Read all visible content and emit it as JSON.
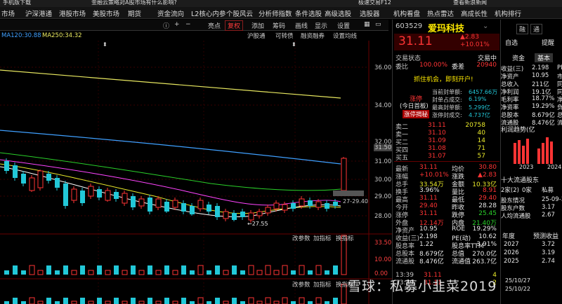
{
  "topbar": {
    "items": [
      "手机版下载",
      "金融云策略对A股市场有什么影响?",
      "极速交易F12",
      "查看新浪新闻"
    ]
  },
  "menubar": {
    "items": [
      "市场",
      "沪深港通",
      "港股市场",
      "美股市场",
      "期货",
      "资金流向",
      "L2核心内参",
      "个股风云",
      "分析师指数",
      "条件选股",
      "高级选股",
      "选股器",
      "机构看盘",
      "热点雷达",
      "高成长性",
      "机构排行"
    ]
  },
  "chart_toolbar": {
    "items": [
      "亮点",
      "复权",
      "添加",
      "筹码",
      "画线",
      "显示",
      "设置"
    ],
    "right_items": [
      "沪股通",
      "可转债",
      "融资融券",
      "设置均线"
    ]
  },
  "ma_legend": {
    "ma120": "MA120:30.88",
    "ma250": "MA250:34.32"
  },
  "colors": {
    "ma120": "#3fa0ff",
    "ma250": "#e8e860",
    "ma5": "#ffffff",
    "ma10": "#e8e82a",
    "ma20": "#ff44ff",
    "ma60": "#2ad02a",
    "up": "#ff3434",
    "down": "#22c8d8"
  },
  "price_axis": {
    "ticks": [
      "36.00",
      "34.00",
      "32.00",
      "31.50",
      "31.00",
      "30.00",
      "29.00",
      "28.00"
    ],
    "current": "31.50"
  },
  "chart_annotations": {
    "low_label": "27.55",
    "range_label": "27-29.40"
  },
  "volume_panel": {
    "buttons": [
      "改参数",
      "加指标",
      "换指标"
    ],
    "ticks": [
      "33.50",
      "10.00",
      "0.00"
    ]
  },
  "indicator_panel": {
    "buttons": [
      "改参数",
      "加指标",
      "换指标"
    ]
  },
  "stock": {
    "code": "603529",
    "name": "爱玛科技",
    "price": "31.11",
    "change": "▲2.83",
    "change_pct": "+10.01%"
  },
  "trade_status": {
    "label": "交易状态",
    "right": "交易中",
    "weibi_label": "委比",
    "weibi": "100.00%",
    "weicha_label": "委差",
    "weicha": "20940"
  },
  "banner": "抓住机会，即刻开户!",
  "limit_up": {
    "title": "涨停",
    "subtitle": "(今日首板)",
    "tag": "涨停揭秘",
    "lines": [
      {
        "label": "当前封单额:",
        "value": "6457.66万"
      },
      {
        "label": "封单占成交:",
        "value": "6.19%"
      },
      {
        "label": "最高封单额:",
        "value": "5.299亿"
      },
      {
        "label": "涨停封成交:",
        "value": "4.737亿"
      }
    ]
  },
  "order_book": {
    "sell": [
      {
        "label": "卖二",
        "price": "31.11",
        "vol": "20758"
      },
      {
        "label": "卖一",
        "price": "31.10",
        "vol": "40"
      },
      {
        "label": "买二",
        "price": "31.09",
        "vol": "14"
      },
      {
        "label": "买四",
        "price": "31.08",
        "vol": "71"
      },
      {
        "label": "买五",
        "price": "31.07",
        "vol": "57"
      }
    ]
  },
  "quote": [
    {
      "l1": "最新",
      "v1": "31.11",
      "c1": "red",
      "l2": "均价",
      "v2": "30.80",
      "c2": "red"
    },
    {
      "l1": "涨幅",
      "v1": "+10.01%",
      "c1": "red",
      "l2": "涨跌",
      "v2": "▲2.83",
      "c2": "red"
    },
    {
      "l1": "总手",
      "v1": "33.54万",
      "c1": "yellow",
      "l2": "金额",
      "v2": "10.33亿",
      "c2": "yellow"
    },
    {
      "l1": "换手",
      "v1": "3.96%",
      "c1": "white",
      "l2": "量比",
      "v2": "8.91",
      "c2": "red"
    },
    {
      "l1": "最高",
      "v1": "31.11",
      "c1": "red",
      "l2": "最低",
      "v2": "29.40",
      "c2": "red"
    },
    {
      "l1": "今开",
      "v1": "29.40",
      "c1": "red",
      "l2": "昨收",
      "v2": "28.28",
      "c2": "white"
    },
    {
      "l1": "涨停",
      "v1": "31.11",
      "c1": "red",
      "l2": "跌停",
      "v2": "25.45",
      "c2": "green"
    },
    {
      "l1": "外盘",
      "v1": "12.14万",
      "c1": "red",
      "l2": "内盘",
      "v2": "21.40万",
      "c2": "green"
    },
    {
      "l1": "净资产",
      "v1": "10.95",
      "c1": "white",
      "l2": "ROE",
      "v2": "19.29%",
      "c2": "white"
    },
    {
      "l1": "收益(三)",
      "v1": "2.198",
      "c1": "white",
      "l2": "PE(动)",
      "v2": "10.62",
      "c2": "white"
    },
    {
      "l1": "股息率",
      "v1": "1.22",
      "c1": "white",
      "l2": "股息率TTM",
      "v2": "3.91%",
      "c2": "white"
    },
    {
      "l1": "总股本",
      "v1": "8.679亿",
      "c1": "white",
      "l2": "总值",
      "v2": "270.0亿",
      "c2": "white"
    },
    {
      "l1": "流通股",
      "v1": "8.476亿",
      "c1": "white",
      "l2": "流通值",
      "v2": "263.7亿",
      "c2": "white"
    }
  ],
  "ticks": [
    {
      "time": "13:39",
      "price": "31.11",
      "vol": "4"
    },
    {
      "time": "13:39",
      "price": "31.11",
      "vol": "2"
    }
  ],
  "far_right": {
    "tabs": [
      "融",
      "通"
    ],
    "self_select": "自选",
    "remind": "提醒",
    "sub_tabs": [
      "资金",
      "基本"
    ],
    "fundamentals": [
      {
        "l": "收益(三)",
        "v": "2.198",
        "x": "PE"
      },
      {
        "l": "净资产",
        "v": "10.95",
        "x": "市"
      },
      {
        "l": "总收入",
        "v": "211亿",
        "x": "同"
      },
      {
        "l": "净利润",
        "v": "19.1亿",
        "x": "同"
      },
      {
        "l": "毛利率",
        "v": "18.77%",
        "x": "净"
      },
      {
        "l": "净资率",
        "v": "19.29%",
        "x": "负"
      },
      {
        "l": "总股本",
        "v": "8.679亿",
        "x": "总"
      },
      {
        "l": "流通股",
        "v": "8.476亿",
        "x": "流"
      }
    ],
    "profit_trend": "利润趋势(亿",
    "years": [
      "2023",
      "2024"
    ],
    "holders_title": "十大流通股东",
    "holders_tabs": [
      "2家(2)",
      "0家",
      "私募"
    ],
    "holders_rows": [
      {
        "l": "股东情况",
        "v": "25-09-3"
      },
      {
        "l": "股东户数",
        "v": "3.17"
      },
      {
        "l": "人均流通股",
        "v": "2.67"
      }
    ],
    "eps_title": "年度",
    "eps_sub": "预测收益",
    "eps_rows": [
      {
        "y": "2027",
        "v": "3.72"
      },
      {
        "y": "2026",
        "v": "3.19"
      },
      {
        "y": "2025",
        "v": "2.74"
      }
    ],
    "bottom": [
      "25/10/27",
      "25/10/22"
    ]
  },
  "watermark": "雪球：私募小韭菜2019"
}
